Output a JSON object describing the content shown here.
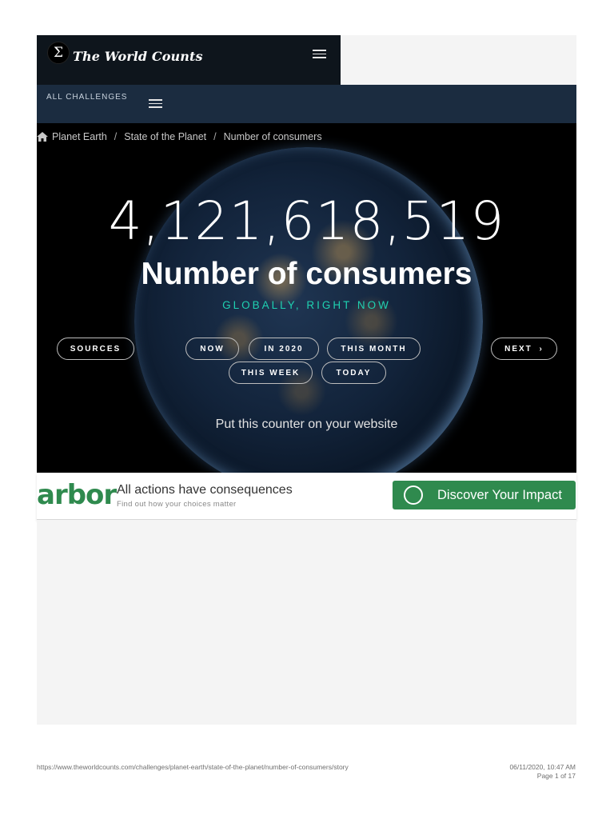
{
  "header": {
    "logo_symbol": "Σ",
    "title": "The World Counts",
    "nav_label": "ALL CHALLENGES"
  },
  "breadcrumb": [
    "Planet Earth",
    "State of the Planet",
    "Number of consumers"
  ],
  "hero": {
    "counter": "4,121,618,519",
    "headline": "Number of consumers",
    "subline": "GLOBALLY, RIGHT NOW",
    "buttons": {
      "sources": "SOURCES",
      "now": "NOW",
      "in_2020": "IN 2020",
      "this_month": "THIS MONTH",
      "next": "NEXT",
      "this_week": "THIS WEEK",
      "today": "TODAY"
    },
    "embed_link": "Put this counter on your website"
  },
  "ad": {
    "brand": "arbor",
    "title": "All actions have consequences",
    "subtitle": "Find out how your choices matter",
    "cta": "Discover Your Impact"
  },
  "footer": {
    "url": "https://www.theworldcounts.com/challenges/planet-earth/state-of-the-planet/number-of-consumers/story",
    "datetime": "06/11/2020, 10:47 AM",
    "page": "Page 1 of 17"
  },
  "colors": {
    "accent_teal": "#1fd1b1",
    "brand_dark": "#0e151c",
    "nav_blue": "#1b2c40",
    "arbor_green": "#2f8a4e"
  }
}
